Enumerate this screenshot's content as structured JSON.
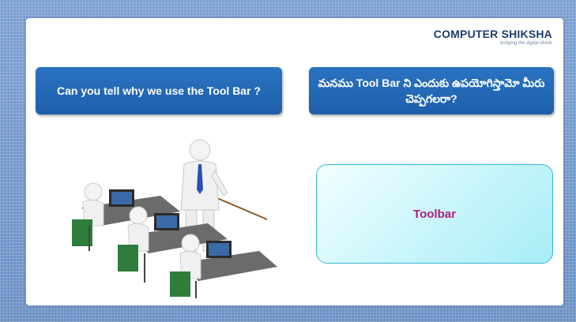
{
  "logo": {
    "name": "COMPUTER SHIKSHA",
    "tagline": "bridging the digital divide"
  },
  "question_en": "Can you tell why we use the Tool Bar ?",
  "question_te": "మనము Tool Bar ని ఎందుకు ఉపయోగిస్తామో మీరు చెప్పగలరా?",
  "answer": "Toolbar"
}
